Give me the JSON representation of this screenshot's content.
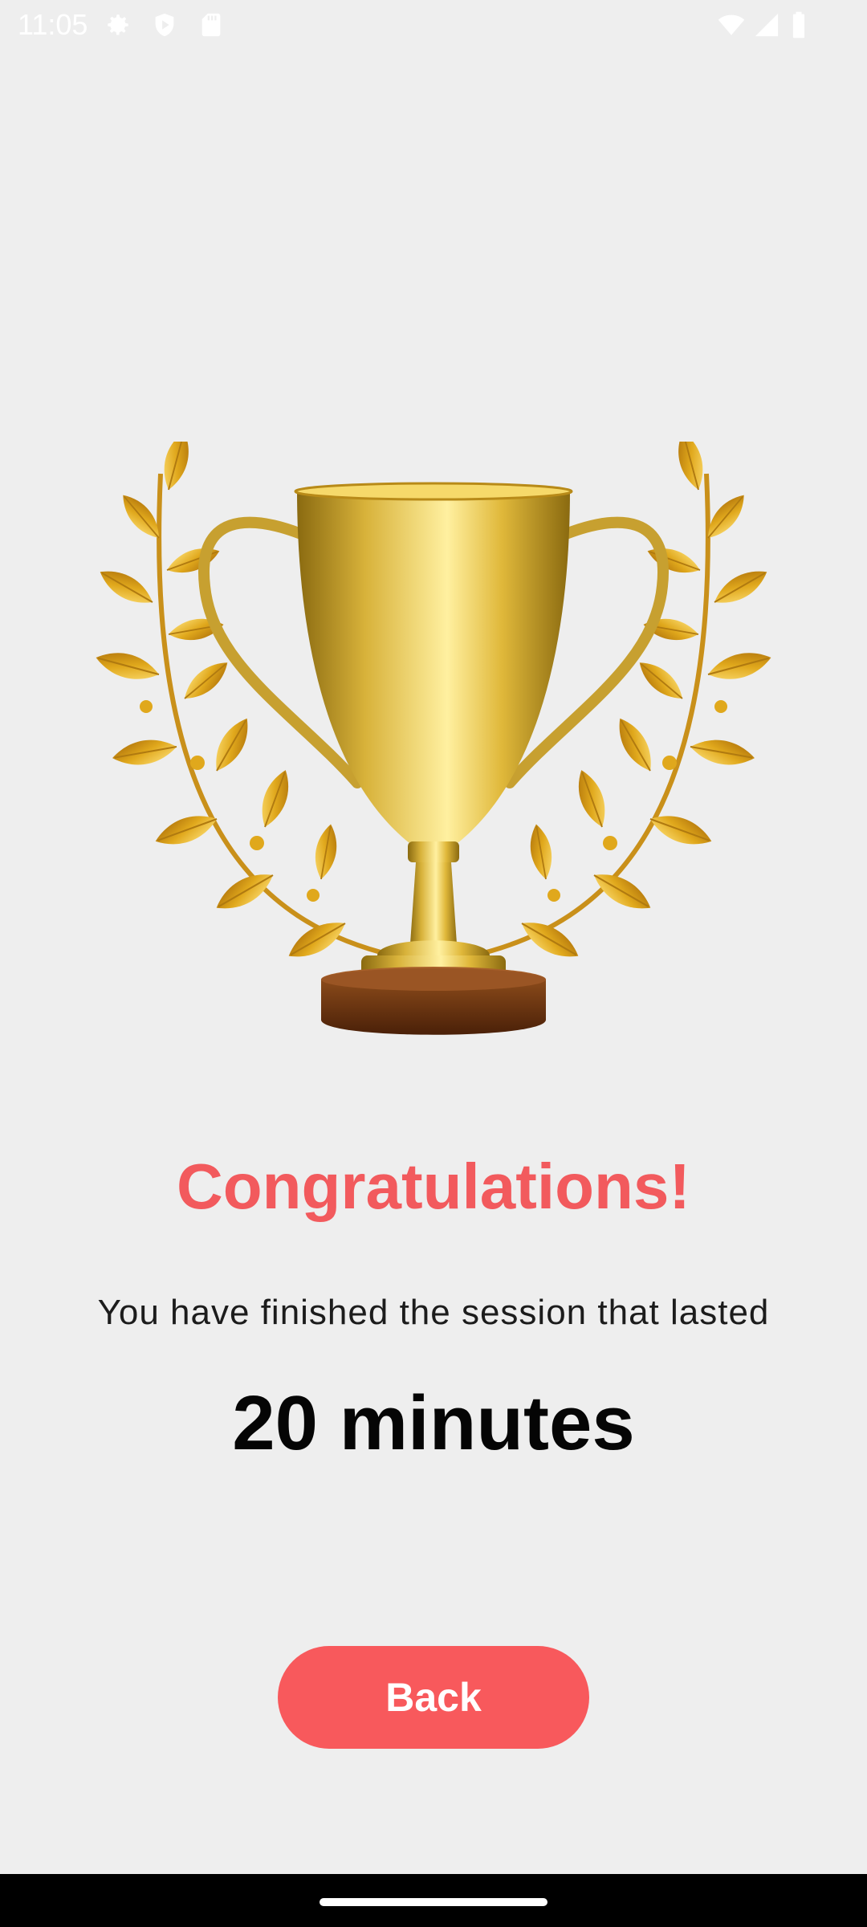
{
  "status_bar": {
    "time": "11:05",
    "left_icons": [
      "gear-icon",
      "shield-play-icon",
      "sd-card-icon"
    ],
    "right_icons": [
      "wifi-icon",
      "cellular-signal-icon",
      "battery-icon"
    ]
  },
  "main": {
    "trophy_icon": "trophy-with-laurel-icon",
    "title": "Congratulations!",
    "subtitle": "You have finished the session that lasted",
    "duration": "20 minutes",
    "back_label": "Back"
  },
  "colors": {
    "accent": "#f8595c",
    "title": "#f25a5d",
    "background": "#eeeeee",
    "gold": "#d4a520"
  }
}
